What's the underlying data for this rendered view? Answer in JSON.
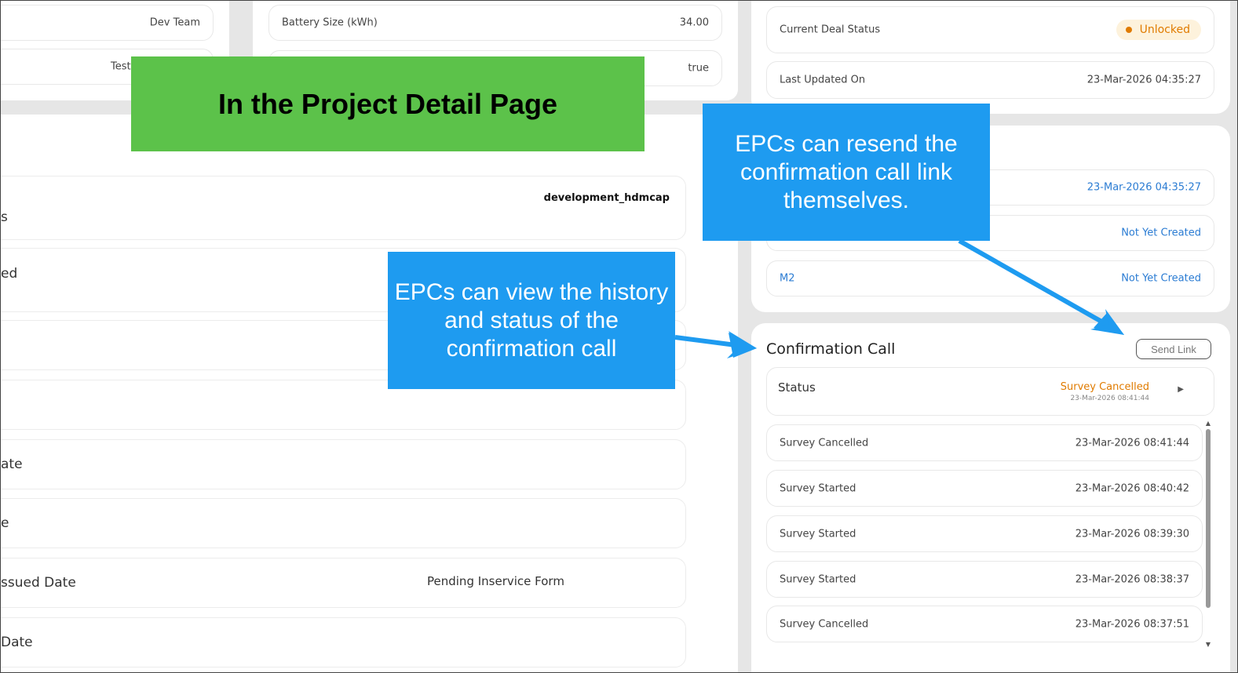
{
  "top_left": {
    "dev_team": "Dev Team",
    "test": "Test"
  },
  "top_mid": {
    "battery_label": "Battery Size (kWh)",
    "battery_value": "34.00",
    "flag_value": "true"
  },
  "left_rows": {
    "owner_value": "development_hdmcap",
    "row1_label": "s",
    "row2_label": "ed",
    "row5_label": "ate",
    "row6_label": "e",
    "row7_label": "ssued Date",
    "row7_value": "Pending Inservice Form",
    "row8_label": "Date"
  },
  "deal": {
    "status_label": "Current Deal Status",
    "status_value": "Unlocked",
    "updated_label": "Last Updated On",
    "updated_value": "23-Mar-2026 04:35:27"
  },
  "milestones": {
    "row1_value": "23-Mar-2026 04:35:27",
    "row2_value": "Not Yet Created",
    "m2_label": "M2",
    "m2_value": "Not Yet Created"
  },
  "confirmation_call": {
    "title": "Confirmation Call",
    "send_link": "Send Link",
    "status_label": "Status",
    "status_value": "Survey Cancelled",
    "status_time": "23-Mar-2026 08:41:44",
    "history": [
      {
        "event": "Survey Cancelled",
        "time": "23-Mar-2026 08:41:44"
      },
      {
        "event": "Survey Started",
        "time": "23-Mar-2026 08:40:42"
      },
      {
        "event": "Survey Started",
        "time": "23-Mar-2026 08:39:30"
      },
      {
        "event": "Survey Started",
        "time": "23-Mar-2026 08:38:37"
      },
      {
        "event": "Survey Cancelled",
        "time": "23-Mar-2026 08:37:51"
      }
    ]
  },
  "annotations": {
    "banner": "In the Project Detail Page",
    "callout_view": "EPCs can view the history and status of the confirmation call",
    "callout_resend": "EPCs can resend the confirmation call link themselves."
  },
  "colors": {
    "accent_blue": "#2b7cd3",
    "warning_orange": "#e07b00",
    "callout_blue": "#1e9bf0",
    "banner_green": "#5cc24a"
  }
}
